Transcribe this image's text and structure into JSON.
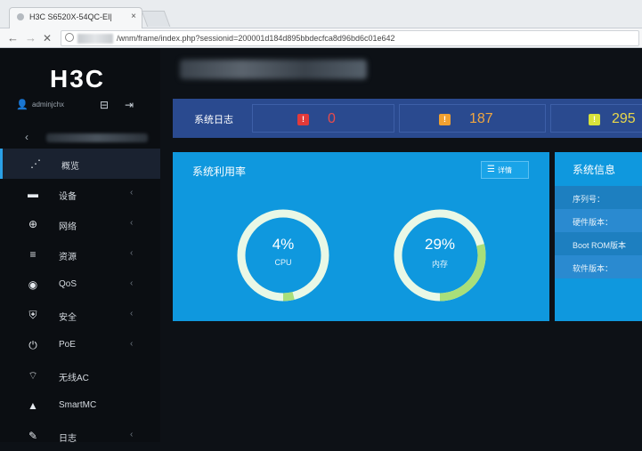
{
  "browser": {
    "tab_title": "H3C S6520X-54QC-EI|",
    "tab_close": "×",
    "url_text": "/wnm/frame/index.php?sessionid=200001d184d895bbdecfca8d96bd6c01e642",
    "back": "←",
    "forward": "→",
    "stop": "✕"
  },
  "sidebar": {
    "logo": "H3C",
    "user": "adminjchx",
    "collapse_arrow": "‹",
    "items": [
      {
        "label": "概览",
        "icon": "dashboard-icon",
        "glyph": "⋰",
        "chevron": ""
      },
      {
        "label": "设备",
        "icon": "device-icon",
        "glyph": "▬",
        "chevron": "‹"
      },
      {
        "label": "网络",
        "icon": "network-icon",
        "glyph": "⊕",
        "chevron": "‹"
      },
      {
        "label": "资源",
        "icon": "database-icon",
        "glyph": "≡",
        "chevron": "‹"
      },
      {
        "label": "QoS",
        "icon": "qos-icon",
        "glyph": "◉",
        "chevron": "‹"
      },
      {
        "label": "安全",
        "icon": "shield-icon",
        "glyph": "⛨",
        "chevron": "‹"
      },
      {
        "label": "PoE",
        "icon": "power-icon",
        "glyph": "⏻",
        "chevron": "‹"
      },
      {
        "label": "无线AC",
        "icon": "wifi-icon",
        "glyph": "⌔",
        "chevron": ""
      },
      {
        "label": "SmartMC",
        "icon": "smartmc-icon",
        "glyph": "▲",
        "chevron": ""
      },
      {
        "label": "日志",
        "icon": "log-icon",
        "glyph": "✎",
        "chevron": "‹"
      }
    ]
  },
  "logbar": {
    "label": "系统日志",
    "entries": [
      {
        "count": "0",
        "badge": "!",
        "color": "#e84b4b",
        "badge_color": "#e23a3a"
      },
      {
        "count": "187",
        "badge": "!",
        "color": "#f0a640",
        "badge_color": "#f0a030"
      },
      {
        "count": "295",
        "badge": "!",
        "color": "#e9d84a",
        "badge_color": "#d8e23a"
      }
    ]
  },
  "sys_usage": {
    "title": "系统利用率",
    "detail_label": "详情",
    "gauges": [
      {
        "percent_text": "4%",
        "label": "CPU",
        "fraction": 0.04
      },
      {
        "percent_text": "29%",
        "label": "内存",
        "fraction": 0.29
      }
    ]
  },
  "sys_info": {
    "title": "系统信息",
    "rows": [
      {
        "label": "序列号："
      },
      {
        "label": "硬件版本："
      },
      {
        "label": "Boot ROM版本"
      },
      {
        "label": "软件版本："
      }
    ]
  },
  "colors": {
    "accent": "#0f98de",
    "gauge_track": "#e9f8e6",
    "gauge_fill": "#a9df7a"
  }
}
